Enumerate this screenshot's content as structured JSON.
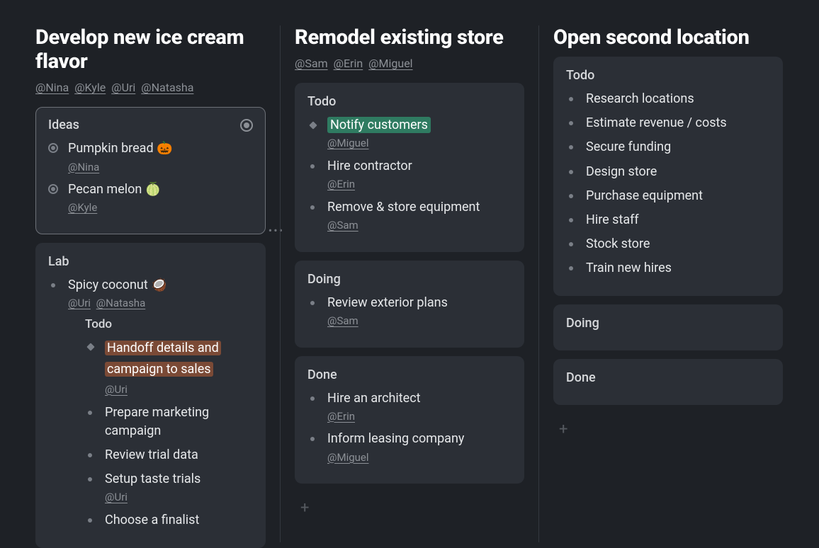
{
  "columns": [
    {
      "title": "Develop new ice cream flavor",
      "assignees": [
        "Nina",
        "Kyle",
        "Uri",
        "Natasha"
      ],
      "stacks": [
        {
          "title": "Ideas",
          "selected": true,
          "headerMarker": "dot",
          "items": [
            {
              "bullet": "radio",
              "text": "Pumpkin bread 🎃",
              "assignees": [
                "Nina"
              ]
            },
            {
              "bullet": "radio",
              "text": "Pecan melon 🍈",
              "assignees": [
                "Kyle"
              ]
            }
          ]
        },
        {
          "title": "Lab",
          "items": [
            {
              "bullet": "dot",
              "text": "Spicy coconut 🥥",
              "assignees": [
                "Uri",
                "Natasha"
              ],
              "children": {
                "sectionLabel": "Todo",
                "items": [
                  {
                    "bullet": "diamond",
                    "text": "Handoff details and campaign to sales",
                    "highlight": "orange",
                    "assignees": [
                      "Uri"
                    ]
                  },
                  {
                    "bullet": "dot",
                    "text": "Prepare marketing campaign"
                  },
                  {
                    "bullet": "dot",
                    "text": "Review trial data"
                  },
                  {
                    "bullet": "dot",
                    "text": "Setup taste trials",
                    "assignees": [
                      "Uri"
                    ]
                  },
                  {
                    "bullet": "dot",
                    "text": "Choose a finalist"
                  }
                ]
              }
            }
          ]
        }
      ]
    },
    {
      "title": "Remodel existing store",
      "assignees": [
        "Sam",
        "Erin",
        "Miguel"
      ],
      "stacks": [
        {
          "title": "Todo",
          "items": [
            {
              "bullet": "diamond",
              "text": "Notify customers",
              "highlight": "green",
              "assignees": [
                "Miguel"
              ]
            },
            {
              "bullet": "dot",
              "text": "Hire contractor",
              "assignees": [
                "Erin"
              ]
            },
            {
              "bullet": "dot",
              "text": "Remove & store equipment",
              "assignees": [
                "Sam"
              ]
            }
          ]
        },
        {
          "title": "Doing",
          "items": [
            {
              "bullet": "dot",
              "text": "Review exterior plans",
              "assignees": [
                "Sam"
              ]
            }
          ]
        },
        {
          "title": "Done",
          "items": [
            {
              "bullet": "dot",
              "text": "Hire an architect",
              "assignees": [
                "Erin"
              ]
            },
            {
              "bullet": "dot",
              "text": "Inform leasing company",
              "assignees": [
                "Miguel"
              ]
            }
          ]
        }
      ],
      "addPlaceholder": "+"
    },
    {
      "title": "Open second location",
      "assignees": [],
      "stacks": [
        {
          "title": "Todo",
          "items": [
            {
              "bullet": "dot",
              "text": "Research locations"
            },
            {
              "bullet": "dot",
              "text": "Estimate revenue / costs"
            },
            {
              "bullet": "dot",
              "text": "Secure funding"
            },
            {
              "bullet": "dot",
              "text": "Design store"
            },
            {
              "bullet": "dot",
              "text": "Purchase equipment"
            },
            {
              "bullet": "dot",
              "text": "Hire staff"
            },
            {
              "bullet": "dot",
              "text": "Stock store"
            },
            {
              "bullet": "dot",
              "text": "Train new hires"
            }
          ]
        },
        {
          "title": "Doing",
          "items": []
        },
        {
          "title": "Done",
          "items": []
        }
      ],
      "addPlaceholder": "+"
    }
  ],
  "dragDots": "•••"
}
